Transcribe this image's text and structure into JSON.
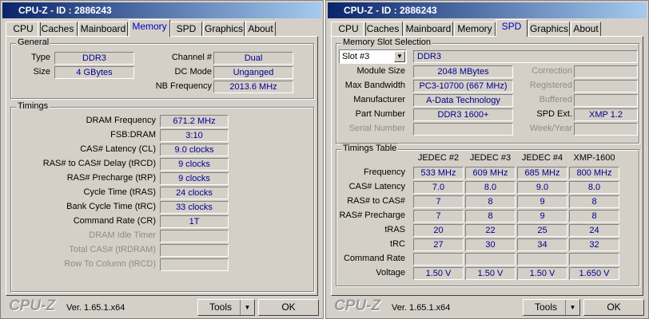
{
  "windows": [
    {
      "title": "CPU-Z - ID : 2886243",
      "active_tab": "Memory"
    },
    {
      "title": "CPU-Z - ID : 2886243",
      "active_tab": "SPD"
    }
  ],
  "tabs": [
    "CPU",
    "Caches",
    "Mainboard",
    "Memory",
    "SPD",
    "Graphics",
    "About"
  ],
  "memory": {
    "general_label": "General",
    "general_left": [
      {
        "label": "Type",
        "value": "DDR3"
      },
      {
        "label": "Size",
        "value": "4 GBytes"
      }
    ],
    "general_right": [
      {
        "label": "Channel #",
        "value": "Dual"
      },
      {
        "label": "DC Mode",
        "value": "Unganged"
      },
      {
        "label": "NB Frequency",
        "value": "2013.6 MHz"
      }
    ],
    "timings_label": "Timings",
    "timings": [
      {
        "label": "DRAM Frequency",
        "value": "671.2 MHz"
      },
      {
        "label": "FSB:DRAM",
        "value": "3:10"
      },
      {
        "label": "CAS# Latency (CL)",
        "value": "9.0 clocks"
      },
      {
        "label": "RAS# to CAS# Delay (tRCD)",
        "value": "9 clocks"
      },
      {
        "label": "RAS# Precharge (tRP)",
        "value": "9 clocks"
      },
      {
        "label": "Cycle Time (tRAS)",
        "value": "24 clocks"
      },
      {
        "label": "Bank Cycle Time (tRC)",
        "value": "33 clocks"
      },
      {
        "label": "Command Rate (CR)",
        "value": "1T"
      },
      {
        "label": "DRAM Idle Timer",
        "value": "",
        "disabled": true
      },
      {
        "label": "Total CAS# (tRDRAM)",
        "value": "",
        "disabled": true
      },
      {
        "label": "Row To Column (tRCD)",
        "value": "",
        "disabled": true
      }
    ]
  },
  "spd": {
    "slot_group_label": "Memory Slot Selection",
    "slot_selected": "Slot #3",
    "slot_type": "DDR3",
    "left_rows": [
      {
        "label": "Module Size",
        "value": "2048 MBytes"
      },
      {
        "label": "Max Bandwidth",
        "value": "PC3-10700 (667 MHz)"
      },
      {
        "label": "Manufacturer",
        "value": "A-Data Technology"
      },
      {
        "label": "Part Number",
        "value": "DDR3 1600+"
      },
      {
        "label": "Serial Number",
        "value": "",
        "disabled": true
      }
    ],
    "right_rows": [
      {
        "label": "Correction",
        "value": "",
        "disabled": true
      },
      {
        "label": "Registered",
        "value": "",
        "disabled": true
      },
      {
        "label": "Buffered",
        "value": "",
        "disabled": true
      },
      {
        "label": "SPD Ext.",
        "value": "XMP 1.2"
      },
      {
        "label": "Week/Year",
        "value": "",
        "disabled": true
      }
    ],
    "table_label": "Timings Table",
    "columns": [
      "JEDEC #2",
      "JEDEC #3",
      "JEDEC #4",
      "XMP-1600"
    ],
    "rows": [
      {
        "label": "Frequency",
        "values": [
          "533 MHz",
          "609 MHz",
          "685 MHz",
          "800 MHz"
        ]
      },
      {
        "label": "CAS# Latency",
        "values": [
          "7.0",
          "8.0",
          "9.0",
          "8.0"
        ]
      },
      {
        "label": "RAS# to CAS#",
        "values": [
          "7",
          "8",
          "9",
          "8"
        ]
      },
      {
        "label": "RAS# Precharge",
        "values": [
          "7",
          "8",
          "9",
          "8"
        ]
      },
      {
        "label": "tRAS",
        "values": [
          "20",
          "22",
          "25",
          "24"
        ]
      },
      {
        "label": "tRC",
        "values": [
          "27",
          "30",
          "34",
          "32"
        ]
      },
      {
        "label": "Command Rate",
        "values": [
          "",
          "",
          "",
          ""
        ]
      },
      {
        "label": "Voltage",
        "values": [
          "1.50 V",
          "1.50 V",
          "1.50 V",
          "1.650 V"
        ]
      }
    ]
  },
  "footer": {
    "logo": "CPU-Z",
    "version": "Ver. 1.65.1.x64",
    "tools": "Tools",
    "ok": "OK"
  }
}
